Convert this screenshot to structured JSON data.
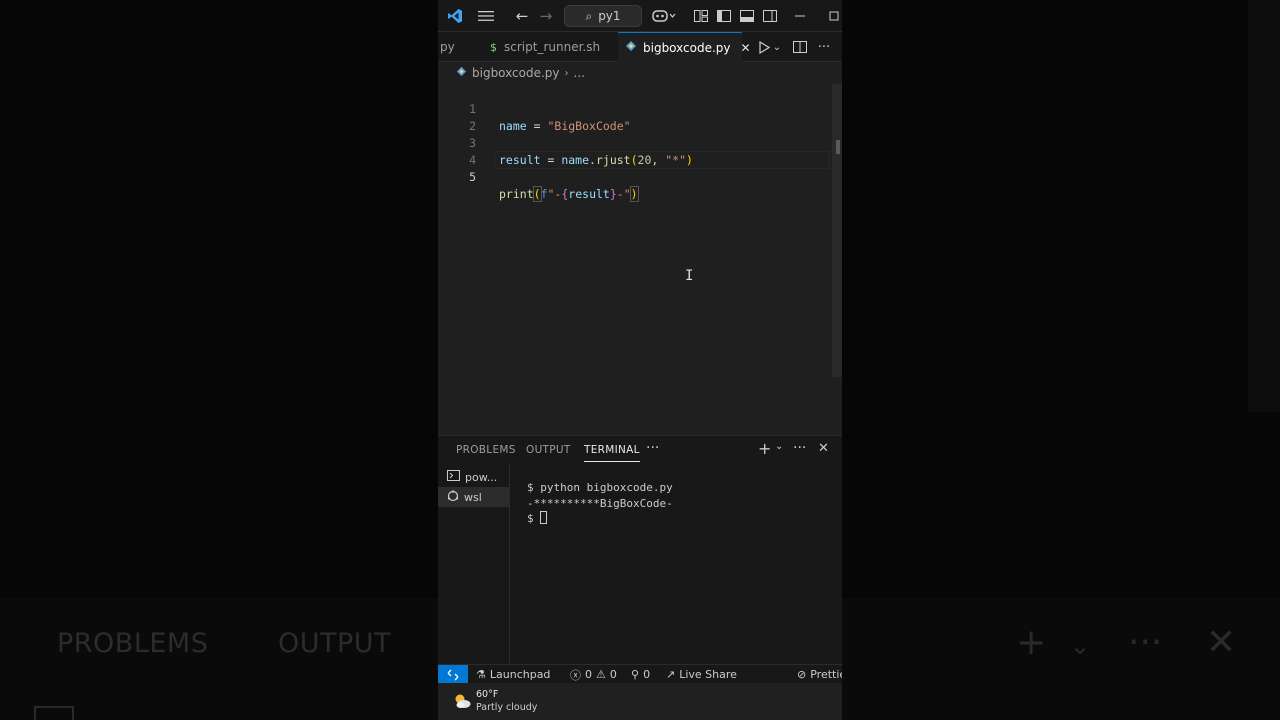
{
  "titlebar": {
    "search_text": "py1"
  },
  "tabs": [
    {
      "label": "py",
      "icon": "python-file-icon"
    },
    {
      "label": "script_runner.sh",
      "icon": "dollar-icon"
    },
    {
      "label": "bigboxcode.py",
      "icon": "python-file-icon",
      "active": true
    }
  ],
  "breadcrumb": {
    "file": "bigboxcode.py",
    "more": "..."
  },
  "editor": {
    "current_line": 5,
    "lines": [
      {
        "num": "1",
        "text": "name = \"BigBoxCode\""
      },
      {
        "num": "2",
        "text": ""
      },
      {
        "num": "3",
        "text": "result = name.rjust(20, \"*\")"
      },
      {
        "num": "4",
        "text": ""
      },
      {
        "num": "5",
        "text": "print(f\"-{result}-\")"
      }
    ],
    "tokens": {
      "l1_var": "name",
      "l1_op": " = ",
      "l1_str": "\"BigBoxCode\"",
      "l3_var": "result",
      "l3_op": " = ",
      "l3_obj": "name",
      "l3_dot": ".",
      "l3_fn": "rjust",
      "l3_open": "(",
      "l3_num": "20",
      "l3_comma": ", ",
      "l3_str": "\"*\"",
      "l3_close": ")",
      "l5_fn": "print",
      "l5_open": "(",
      "l5_f": "f",
      "l5_str1": "\"-",
      "l5_lb": "{",
      "l5_var": "result",
      "l5_rb": "}",
      "l5_str2": "-\"",
      "l5_close": ")"
    }
  },
  "panel": {
    "tabs": [
      "PROBLEMS",
      "OUTPUT",
      "TERMINAL"
    ],
    "active_tab": "TERMINAL",
    "terminals": [
      {
        "label": "pow...",
        "icon": "terminal-icon"
      },
      {
        "label": "wsl",
        "icon": "linux-icon",
        "selected": true
      }
    ],
    "output_lines": [
      "$ python bigboxcode.py",
      "-**********BigBoxCode-",
      "$ "
    ]
  },
  "statusbar": {
    "launchpad": "Launchpad",
    "errors": "0",
    "warnings": "0",
    "ports": "0",
    "live_share": "Live Share",
    "prettier": "Prettie"
  },
  "taskbar": {
    "temperature": "60°F",
    "condition": "Partly cloudy"
  },
  "background_echo": {
    "problems": "PROBLEMS",
    "output": "OUTPUT"
  },
  "colors": {
    "accent": "#0078d4",
    "editor_bg": "#1f1f1f",
    "chrome_bg": "#181818"
  }
}
